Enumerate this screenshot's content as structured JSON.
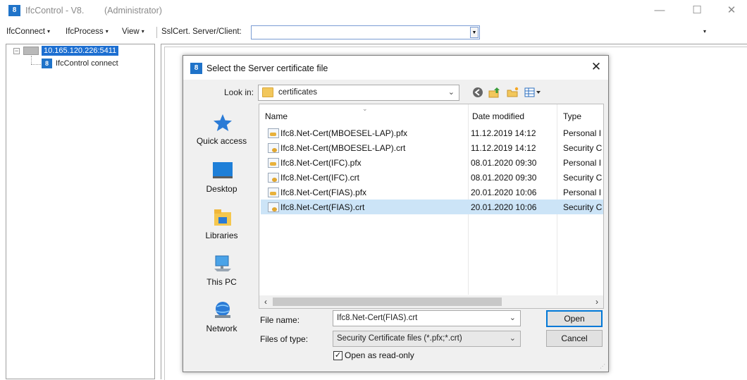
{
  "window": {
    "icon": "app-logo-icon",
    "title": "IfcControl - V8.",
    "admin": "(Administrator)",
    "controls": {
      "minimize": "—",
      "maximize": "☐",
      "close": "✕"
    }
  },
  "menubar": {
    "items": [
      {
        "label": "IfcConnect",
        "caret": "▾"
      },
      {
        "label": "IfcProcess",
        "caret": "▾"
      },
      {
        "label": "View",
        "caret": "▾"
      }
    ],
    "ssl_label": "SslCert. Server/Client:",
    "ssl_value": "",
    "overflow": "▾"
  },
  "tree": {
    "expander": "−",
    "root_label": "10.165.120.226:5411",
    "child_label": "IfcControl connect",
    "child_icon": "app-logo-icon"
  },
  "dialog": {
    "title": "Select the Server certificate file",
    "close": "✕",
    "look_in_label": "Look in:",
    "look_in_value": "certificates",
    "toolbar_icons": [
      "back-icon",
      "up-folder-icon",
      "new-folder-icon",
      "view-menu-icon"
    ],
    "places": [
      {
        "label": "Quick access",
        "icon": "star-icon"
      },
      {
        "label": "Desktop",
        "icon": "desktop-icon"
      },
      {
        "label": "Libraries",
        "icon": "libraries-icon"
      },
      {
        "label": "This PC",
        "icon": "computer-icon"
      },
      {
        "label": "Network",
        "icon": "network-icon"
      }
    ],
    "columns": [
      "Name",
      "Date modified",
      "Type"
    ],
    "files": [
      {
        "name": "Ifc8.Net-Cert(MBOESEL-LAP).pfx",
        "date": "11.12.2019 14:12",
        "type": "Personal I",
        "kind": "pfx"
      },
      {
        "name": "Ifc8.Net-Cert(MBOESEL-LAP).crt",
        "date": "11.12.2019 14:12",
        "type": "Security C",
        "kind": "crt"
      },
      {
        "name": "Ifc8.Net-Cert(IFC).pfx",
        "date": "08.01.2020 09:30",
        "type": "Personal I",
        "kind": "pfx"
      },
      {
        "name": "Ifc8.Net-Cert(IFC).crt",
        "date": "08.01.2020 09:30",
        "type": "Security C",
        "kind": "crt"
      },
      {
        "name": "Ifc8.Net-Cert(FIAS).pfx",
        "date": "20.01.2020 10:06",
        "type": "Personal I",
        "kind": "pfx"
      },
      {
        "name": "Ifc8.Net-Cert(FIAS).crt",
        "date": "20.01.2020 10:06",
        "type": "Security C",
        "kind": "crt"
      }
    ],
    "selected_index": 5,
    "file_name_label": "File name:",
    "file_name_value": "Ifc8.Net-Cert(FIAS).crt",
    "file_type_label": "Files of type:",
    "file_type_value": "Security Certificate files (*.pfx;*.crt)",
    "open_label": "Open",
    "cancel_label": "Cancel",
    "readonly_label": "Open as read-only",
    "readonly_checked": true,
    "check_mark": "✓"
  },
  "colors": {
    "accent": "#0078d7",
    "selection": "#cce4f7",
    "tree_selection": "#1d6fd1",
    "logo": "#1f73c9"
  }
}
